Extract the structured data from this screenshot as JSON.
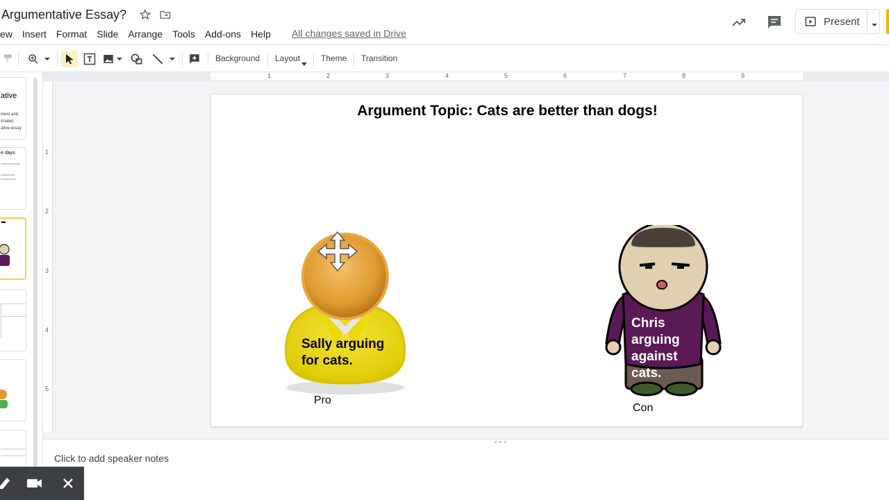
{
  "document": {
    "title": "Argumentative Essay?",
    "saved_status": "All changes saved in Drive"
  },
  "menu": [
    "ew",
    "Insert",
    "Format",
    "Slide",
    "Arrange",
    "Tools",
    "Add-ons",
    "Help"
  ],
  "header": {
    "present_label": "Present"
  },
  "toolbar": {
    "background_label": "Background",
    "layout_label": "Layout",
    "theme_label": "Theme",
    "transition_label": "Transition"
  },
  "rulers": {
    "horizontal": [
      "1",
      "2",
      "3",
      "4",
      "5",
      "6",
      "7",
      "8",
      "9"
    ],
    "vertical": [
      "1",
      "2",
      "3",
      "4",
      "5"
    ]
  },
  "filmstrip": {
    "thumb1_title": "ative",
    "thumb1_lines": [
      "ment and",
      "(make)",
      "ative essay"
    ],
    "thumb2_title": "e days."
  },
  "slide": {
    "title": "Argument Topic: Cats are better than dogs!",
    "pro_figure_text": "Sally arguing for cats.",
    "con_figure_text": "Chris arguing against cats.",
    "pro_label": "Pro",
    "con_label": "Con"
  },
  "speaker_notes": {
    "placeholder": "Click to add speaker notes"
  },
  "colors": {
    "sally_body": "#e8d40c",
    "sally_head": "#e09a30",
    "chris_shirt": "#5a1a56",
    "chris_skin": "#e0cfb0",
    "selected_thumb_border": "#f7cb4d"
  }
}
